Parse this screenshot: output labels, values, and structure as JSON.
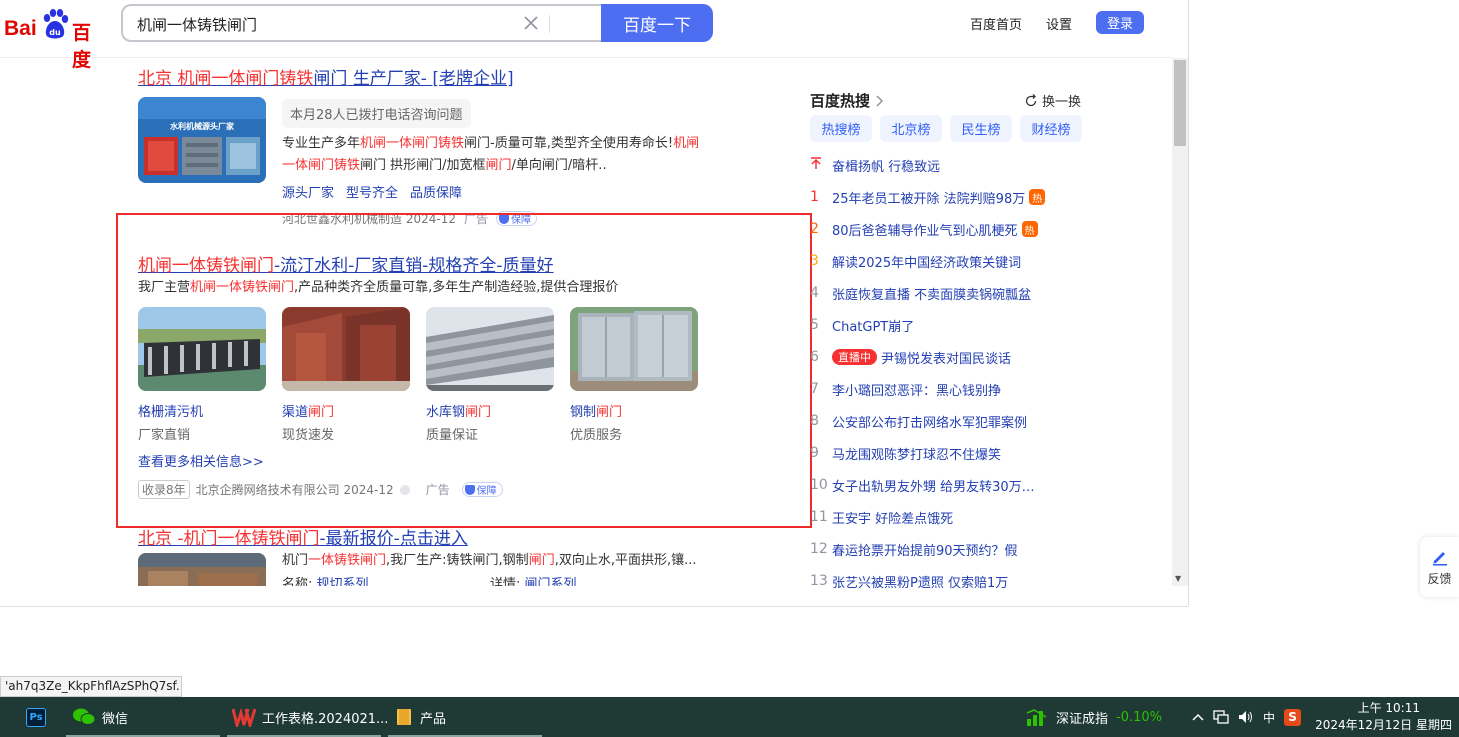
{
  "search": {
    "query": "机闸一体铸铁闸门",
    "button": "百度一下"
  },
  "logo": {
    "bai": "Bai",
    "du": "du",
    "cn": "百度"
  },
  "nav": {
    "home": "百度首页",
    "settings": "设置",
    "login": "登录"
  },
  "result1": {
    "title_a": "北京",
    "title_b": "机闸一体闸门铸铁",
    "title_c": "闸门",
    "title_d": "生产厂家-",
    "title_e": "[老牌企业]",
    "pill": "本月28人已拨打电话咨询问题",
    "thumb_text": "水利机械源头厂家",
    "desc_1": "专业生产多年",
    "desc_2": "机闸一体闸门铸铁",
    "desc_3": "闸门-质量可靠,类型齐全使用寿命长!",
    "desc_4": "机闸一体闸门铸铁",
    "desc_5": "闸门 拱形闸门/加宽框",
    "desc_6": "闸门",
    "desc_7": "/单向闸门/暗杆..",
    "links": [
      "源头厂家",
      "型号齐全",
      "品质保障"
    ],
    "source": "河北世鑫水利机械制造 2024-12",
    "ad": "广告",
    "guarantee": "保障"
  },
  "result2": {
    "title_a": "机闸一体铸铁闸门",
    "title_b": "-流汀水利-厂家直销-规格齐全-质量好",
    "desc_a": "我厂主营",
    "desc_b": "机闸一体铸铁闸门",
    "desc_c": ",产品种类齐全质量可靠,多年生产制造经验,提供合理报价",
    "items": [
      {
        "name_a": "格栅清污机",
        "name_b": "",
        "sub": "厂家直销"
      },
      {
        "name_a": "渠道",
        "name_b": "闸门",
        "sub": "现货速发"
      },
      {
        "name_a": "水库钢",
        "name_b": "闸门",
        "sub": "质量保证"
      },
      {
        "name_a": "钢制",
        "name_b": "闸门",
        "sub": "优质服务"
      }
    ],
    "more": "查看更多相关信息>>",
    "tag": "收录8年",
    "source": "北京企腾网络技术有限公司 2024-12",
    "ad": "广告",
    "guarantee": "保障"
  },
  "result3": {
    "title_a": "北京",
    "title_b": "-机门一体铸铁闸门",
    "title_c": "-最新报价-点击进入",
    "desc_a": "机门",
    "desc_b": "一体铸铁闸门",
    "desc_c": ",我厂生产:铸铁闸门,钢制",
    "desc_d": "闸门",
    "desc_e": ",双向止水,平面拱形,镶...",
    "meta_a": "名称:",
    "meta_b": "规切系列",
    "meta_c": "详情:",
    "meta_d": "闸门系列"
  },
  "hot": {
    "title": "百度热搜",
    "refresh": "换一换",
    "tabs": [
      "热搜榜",
      "北京榜",
      "民生榜",
      "财经榜"
    ],
    "items": [
      {
        "rank": "",
        "text": "奋楫扬帆 行稳致远",
        "badge": "",
        "rank_color": "#f73131"
      },
      {
        "rank": "1",
        "text": "25年老员工被开除 法院判赔98万",
        "badge": "热",
        "rank_color": "#f73131"
      },
      {
        "rank": "2",
        "text": "80后爸爸辅导作业气到心肌梗死",
        "badge": "热",
        "rank_color": "#ff6600"
      },
      {
        "rank": "3",
        "text": "解读2025年中国经济政策关键词",
        "badge": "",
        "rank_color": "#faa90e"
      },
      {
        "rank": "4",
        "text": "张庭恢复直播 不卖面膜卖锅碗瓢盆",
        "badge": "",
        "rank_color": "#9195a3"
      },
      {
        "rank": "5",
        "text": "ChatGPT崩了",
        "badge": "",
        "rank_color": "#9195a3"
      },
      {
        "rank": "6",
        "text": "尹锡悦发表对国民谈话",
        "badge": "",
        "live": "直播中",
        "rank_color": "#9195a3"
      },
      {
        "rank": "7",
        "text": "李小璐回怼恶评：黑心钱别挣",
        "badge": "",
        "rank_color": "#9195a3"
      },
      {
        "rank": "8",
        "text": "公安部公布打击网络水军犯罪案例",
        "badge": "",
        "rank_color": "#9195a3"
      },
      {
        "rank": "9",
        "text": "马龙围观陈梦打球忍不住爆笑",
        "badge": "",
        "rank_color": "#9195a3"
      },
      {
        "rank": "10",
        "text": "女子出轨男友外甥 给男友转30万…",
        "badge": "",
        "rank_color": "#9195a3"
      },
      {
        "rank": "11",
        "text": "王安宇 好险差点饿死",
        "badge": "",
        "rank_color": "#9195a3"
      },
      {
        "rank": "12",
        "text": "春运抢票开始提前90天预约？假",
        "badge": "",
        "rank_color": "#9195a3"
      },
      {
        "rank": "13",
        "text": "张艺兴被黑粉P遗照 仅索赔1万",
        "badge": "",
        "rank_color": "#9195a3"
      }
    ]
  },
  "feedback": "反馈",
  "status_url": "'ah7q3Ze_KkpFhflAzSPhQ7sf...",
  "taskbar": {
    "ps": "Ps",
    "wechat": "微信",
    "wps": "工作表格.2024021...",
    "folder": "产品",
    "stock_name": "深证成指",
    "stock_value": "-0.10%",
    "ime": "中",
    "time": "上午 10:11",
    "date": "2024年12月12日 星期四"
  },
  "colors": {
    "accent": "#4e6ef2",
    "link": "#2440b3",
    "highlight": "#f73131",
    "taskbar": "#1f3a35"
  }
}
